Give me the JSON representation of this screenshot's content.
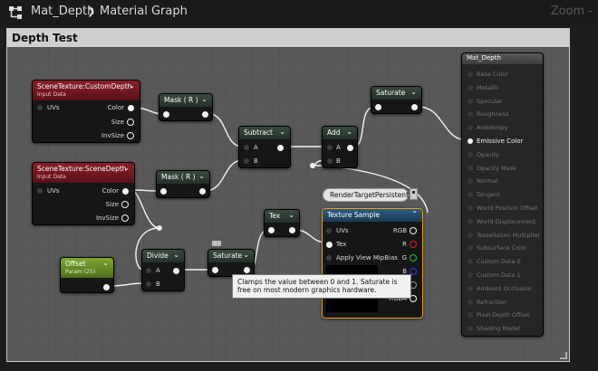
{
  "breadcrumb": {
    "asset": "Mat_Depth",
    "separator": "❯",
    "graph": "Material Graph"
  },
  "zoom_label": "Zoom -",
  "comment_title": "Depth Test",
  "nodes": {
    "custom_depth": {
      "title": "SceneTexture:CustomDepth",
      "subtitle": "Input Data",
      "input": "UVs",
      "outputs": [
        "Color",
        "Size",
        "InvSize"
      ]
    },
    "scene_depth": {
      "title": "SceneTexture:SceneDepth",
      "subtitle": "Input Data",
      "input": "UVs",
      "outputs": [
        "Color",
        "Size",
        "InvSize"
      ]
    },
    "mask1": {
      "title": "Mask ( R )"
    },
    "mask2": {
      "title": "Mask ( R )"
    },
    "subtract": {
      "title": "Subtract",
      "inputs": [
        "A",
        "B"
      ]
    },
    "add": {
      "title": "Add",
      "inputs": [
        "A",
        "B"
      ]
    },
    "saturate1": {
      "title": "Saturate"
    },
    "saturate2": {
      "title": "Saturate"
    },
    "divide": {
      "title": "Divide",
      "inputs": [
        "A",
        "B"
      ]
    },
    "offset": {
      "title": "Offset",
      "subtitle": "Param (25)"
    },
    "tex": {
      "title": "Tex"
    },
    "texture_sample": {
      "title": "Texture Sample",
      "inputs": [
        "UVs",
        "Tex",
        "Apply View MipBias"
      ],
      "outputs": [
        "RGB",
        "R",
        "G",
        "B",
        "A",
        "RGBA"
      ]
    },
    "material": {
      "title": "Mat_Depth",
      "pins": [
        "Base Color",
        "Metallic",
        "Specular",
        "Roughness",
        "Anisotropy",
        "Emissive Color",
        "Opacity",
        "Opacity Mask",
        "Normal",
        "Tangent",
        "World Position Offset",
        "World Displacement",
        "Tessellation Multiplier",
        "Subsurface Color",
        "Custom Data 0",
        "Custom Data 1",
        "Ambient Occlusion",
        "Refraction",
        "Pixel Depth Offset",
        "Shading Model"
      ],
      "active_pin": "Emissive Color"
    }
  },
  "render_target_label": "RenderTargetPersistent",
  "tooltip": "Clamps the value between 0 and 1. Saturate is free on most modern graphics hardware.",
  "colors": {
    "red_header": "#8a1e26",
    "green_header": "#7fa832",
    "blue_header": "#2d5d80",
    "selection_orange": "#e8a020"
  }
}
